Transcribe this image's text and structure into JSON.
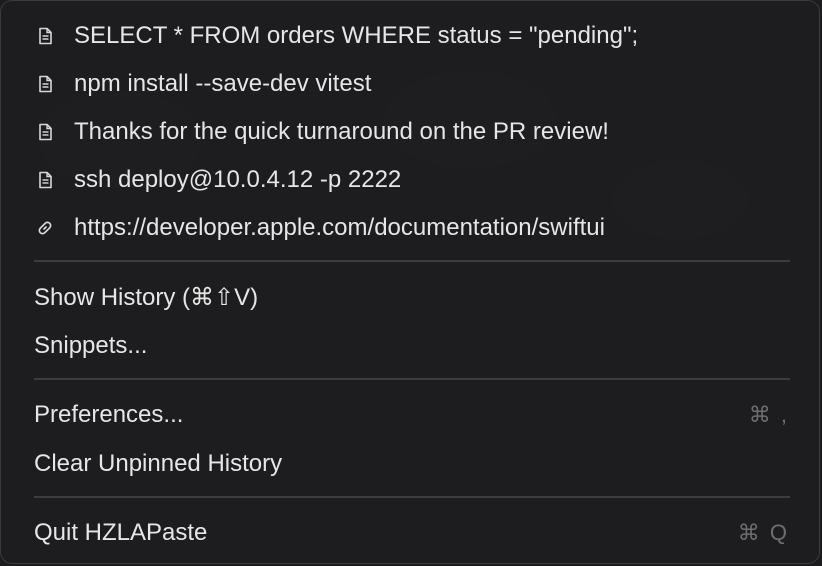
{
  "clipboard_items": [
    {
      "label": "SELECT * FROM orders WHERE status = \"pending\";",
      "icon": "document-icon"
    },
    {
      "label": "npm install --save-dev vitest",
      "icon": "document-icon"
    },
    {
      "label": "Thanks for the quick turnaround on the PR review!",
      "icon": "document-icon"
    },
    {
      "label": "ssh deploy@10.0.4.12 -p 2222",
      "icon": "document-icon"
    },
    {
      "label": "https://developer.apple.com/documentation/swiftui",
      "icon": "link-icon"
    }
  ],
  "history": {
    "show_history_label": "Show History (⌘⇧V)",
    "snippets_label": "Snippets..."
  },
  "settings": {
    "preferences_label": "Preferences...",
    "preferences_shortcut": "⌘ ,",
    "clear_label": "Clear Unpinned History"
  },
  "app": {
    "quit_label": "Quit HZLAPaste",
    "quit_shortcut": "⌘ Q"
  },
  "colors": {
    "text": "#e6e6e6",
    "shortcut": "#6e6e72",
    "divider": "#3d3d40"
  }
}
